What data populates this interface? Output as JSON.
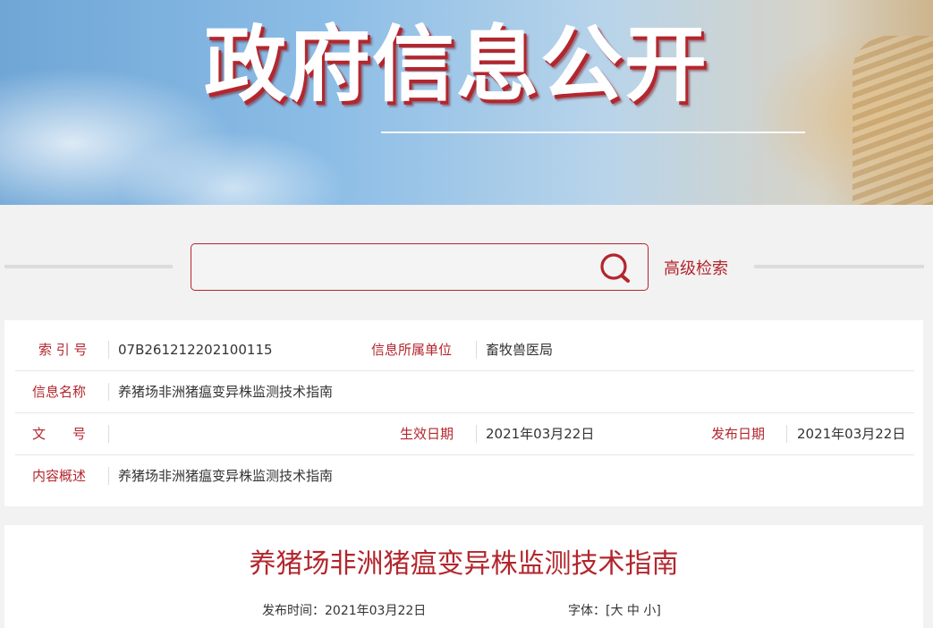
{
  "banner": {
    "title": "政府信息公开"
  },
  "search": {
    "placeholder": "",
    "value": "",
    "advanced_label": "高级检索"
  },
  "meta": {
    "index_label": "索 引 号",
    "index_value": "07B261212202100115",
    "unit_label": "信息所属单位",
    "unit_value": "畜牧兽医局",
    "name_label": "信息名称",
    "name_value": "养猪场非洲猪瘟变异株监测技术指南",
    "doc_no_label": "文　　号",
    "doc_no_value": "",
    "effective_label": "生效日期",
    "effective_value": "2021年03月22日",
    "publish_label": "发布日期",
    "publish_value": "2021年03月22日",
    "summary_label": "内容概述",
    "summary_value": "养猪场非洲猪瘟变异株监测技术指南"
  },
  "article": {
    "title": "养猪场非洲猪瘟变异株监测技术指南",
    "publish_time_label": "发布时间：",
    "publish_time_value": "2021年03月22日",
    "font_label": "字体：",
    "font_open": "[",
    "font_large": "大",
    "font_medium": "中",
    "font_small": "小",
    "font_close": "]"
  },
  "colors": {
    "accent": "#b3262d",
    "background": "#f2f2f2",
    "card": "#ffffff"
  }
}
